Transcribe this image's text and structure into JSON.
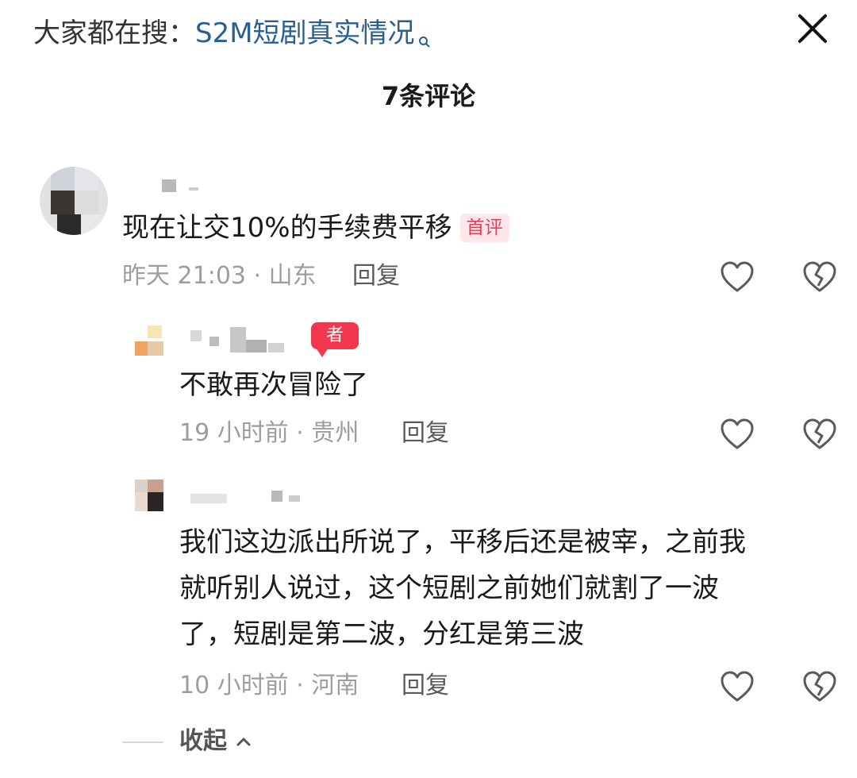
{
  "search_suggest": {
    "prefix": "大家都在搜：",
    "query": "S2M短剧真实情况"
  },
  "comment_count": "7条评论",
  "comments": [
    {
      "text": "现在让交10%的手续费平移",
      "tag": "首评",
      "time_location": "昨天 21:03 · 山东",
      "reply": "回复"
    },
    {
      "author_tag": "者",
      "text": "不敢再次冒险了",
      "time_location": "19 小时前 · 贵州",
      "reply": "回复"
    },
    {
      "text_lines": [
        "我们这边派出所说了，平移后还是被宰，之前我",
        "就听别人说过，这个短剧之前她们就割了一波",
        "了，短剧是第二波，分红是第三波"
      ],
      "time_location": "10 小时前 · 河南",
      "reply": "回复"
    }
  ],
  "collapse_label": "收起",
  "icons": [
    "search-suggest-icon",
    "close-icon",
    "heart-icon",
    "broken-heart-icon",
    "chevron-up-icon"
  ],
  "colors": {
    "query_link": "#2a5f8f",
    "first_tag_bg": "#fde7ea",
    "first_tag_text": "#e13e58",
    "author_tag": "#f0374e"
  }
}
